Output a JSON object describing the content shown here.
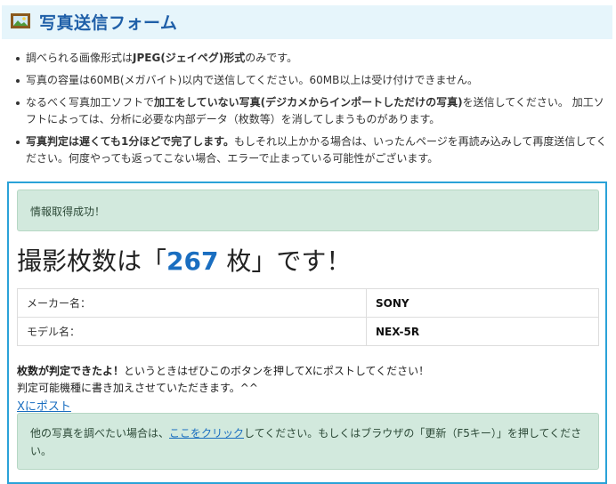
{
  "header": {
    "icon": "picture-frame-icon",
    "title": "写真送信フォーム",
    "colors": {
      "background": "#e6f5fb",
      "title": "#1f5fa8"
    }
  },
  "notes": [
    {
      "pre": "調べられる画像形式は",
      "bold": "JPEG(ジェイペグ)形式",
      "post": "のみです。"
    },
    {
      "pre": "写真の容量は60MB(メガバイト)以内で送信してください。60MB以上は受け付けできません。",
      "bold": "",
      "post": ""
    },
    {
      "pre": "なるべく写真加工ソフトで",
      "bold": "加工をしていない写真(デジカメからインポートしただけの写真)",
      "post": "を送信してください。 加工ソフトによっては、分析に必要な内部データ（枚数等）を消してしまうものがあります。"
    },
    {
      "pre": "",
      "bold": "写真判定は遅くても1分ほどで完了します。",
      "post": "もしそれ以上かかる場合は、いったんページを再読み込みして再度送信してください。何度やっても返ってこない場合、エラーで止まっている可能性がございます。"
    }
  ],
  "result": {
    "status_message": "情報取得成功！",
    "count_prefix": "撮影枚数は「",
    "count_value": "267",
    "count_suffix": " 枚」です！",
    "table": [
      {
        "label": "メーカー名：",
        "value": "SONY"
      },
      {
        "label": "モデル名：",
        "value": "NEX-5R"
      }
    ],
    "share_bold": "枚数が判定できたよ！",
    "share_text": "というときはぜひこのボタンを押してXにポストしてください！",
    "share_note": "判定可能機種に書き加えさせていただきます。^^",
    "share_link": "Xにポスト",
    "next_pre": "他の写真を調べたい場合は、",
    "next_link": "ここをクリック",
    "next_post": "してください。もしくはブラウザの「更新（F5キー）」を押してください。",
    "colors": {
      "border": "#2aa2d8",
      "alert_bg": "#d2e9dd",
      "count": "#1a6ec0"
    }
  }
}
